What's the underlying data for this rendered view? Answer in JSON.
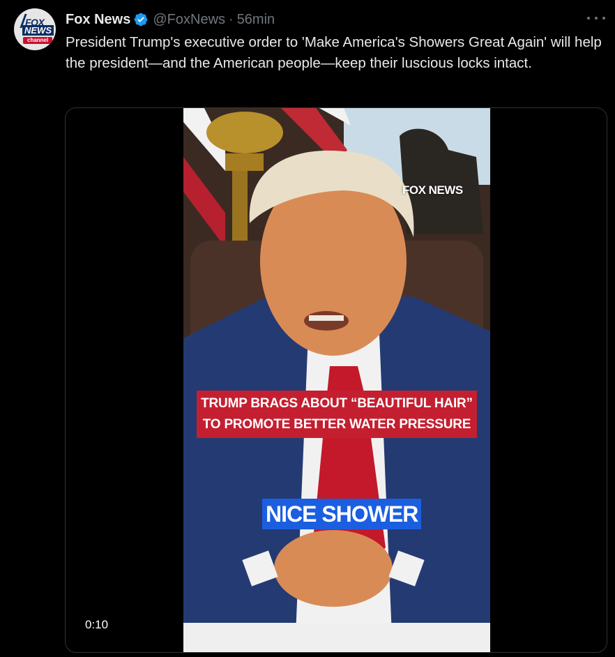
{
  "tweet": {
    "display_name": "Fox News",
    "handle": "@FoxNews",
    "separator": "·",
    "time": "56min",
    "text": "President Trump's executive order to 'Make America's Showers Great Again' will help the president—and the American people—keep their luscious locks intact.",
    "more_icon": "ellipsis-icon",
    "verified_icon": "verified-badge-icon",
    "verified_color": "#1d9bf0"
  },
  "avatar": {
    "logo_fox": "FOX",
    "logo_news": "NEWS",
    "logo_channel": "channel"
  },
  "video": {
    "watermark": "FOX NEWS",
    "caption_line1": "TRUMP BRAGS ABOUT “BEAUTIFUL HAIR”",
    "caption_line2": "TO PROMOTE BETTER WATER PRESSURE",
    "caption_red_color": "#c41f30",
    "subtitle": "NICE SHOWER",
    "subtitle_color": "#1b5fe0",
    "duration": "0:10"
  }
}
